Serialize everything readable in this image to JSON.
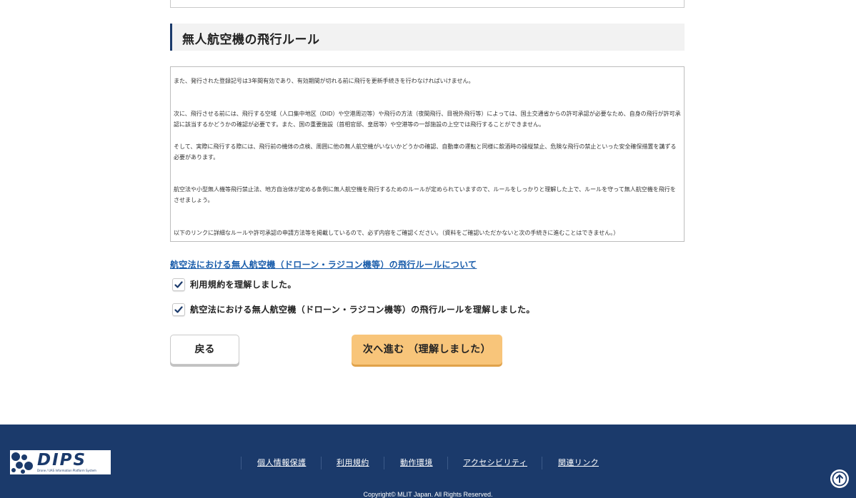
{
  "section": {
    "title": "無人航空機の飛行ルール"
  },
  "rules": {
    "paragraphs": [
      "また、発行された登録記号は3年間有効であり、有効期間が切れる前に飛行を更新手続きを行わなければいけません。",
      "次に、飛行させる前には、飛行する空域（人口集中地区（DID）や空港周辺等）や飛行の方法（夜間飛行、目視外飛行等）によっては、国土交通省からの許可承認が必要なため、自身の飛行が許可承認に該当するかどうかの確認が必要です。また、国の重要施設（首相官邸、皇居等）や空港等の一部施設の上空では飛行することができません。",
      "そして、実際に飛行する際には、飛行前の機体の点検、周囲に他の無人航空機がいないかどうかの確認、自動車の運転と同様に飲酒時の操縦禁止、危険な飛行の禁止といった安全確保措置を講ずる必要があります。",
      "航空法や小型無人機等飛行禁止法、地方自治体が定める条例に無人航空機を飛行するためのルールが定められていますので、ルールをしっかりと理解した上で、ルールを守って無人航空機を飛行をさせましょう。",
      "以下のリンクに詳細なルールや許可承認の申請方法等を掲載しているので、必ず内容をご確認ください。（資料をご確認いただかないと次の手続きに進むことはできません。）"
    ]
  },
  "link": {
    "label": "航空法における無人航空機（ドローン・ラジコン機等）の飛行ルールについて"
  },
  "checks": [
    {
      "label": "利用規約を理解しました。",
      "checked": true
    },
    {
      "label": "航空法における無人航空機（ドローン・ラジコン機等）の飛行ルールを理解しました。",
      "checked": true
    }
  ],
  "buttons": {
    "back": "戻る",
    "next": "次へ進む （理解しました）"
  },
  "footer": {
    "logo_text": "DIPS",
    "logo_sub": "Drone / UAS Information Platform System",
    "links": [
      "個人情報保護",
      "利用規約",
      "動作環境",
      "アクセシビリティ",
      "関連リンク"
    ],
    "copyright": "Copyright© MLIT Japan. All Rights Reserved."
  },
  "colors": {
    "brand_navy": "#1b3a6b",
    "link_blue": "#1a5dab",
    "next_button": "#f8c57a"
  }
}
